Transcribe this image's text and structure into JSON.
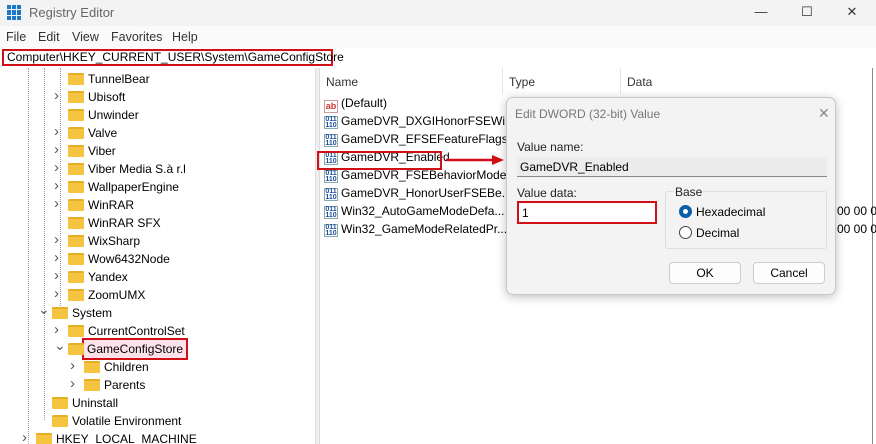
{
  "window": {
    "title": "Registry Editor",
    "minimize": "—",
    "maximize": "☐",
    "close": "✕"
  },
  "menu": [
    "File",
    "Edit",
    "View",
    "Favorites",
    "Help"
  ],
  "address": "Computer\\HKEY_CURRENT_USER\\System\\GameConfigStore",
  "tree": [
    {
      "label": "TunnelBear",
      "level": 3,
      "chev": ""
    },
    {
      "label": "Ubisoft",
      "level": 3,
      "chev": ">"
    },
    {
      "label": "Unwinder",
      "level": 3,
      "chev": ""
    },
    {
      "label": "Valve",
      "level": 3,
      "chev": ">"
    },
    {
      "label": "Viber",
      "level": 3,
      "chev": ">"
    },
    {
      "label": "Viber Media S.à r.l",
      "level": 3,
      "chev": ">"
    },
    {
      "label": "WallpaperEngine",
      "level": 3,
      "chev": ">"
    },
    {
      "label": "WinRAR",
      "level": 3,
      "chev": ">"
    },
    {
      "label": "WinRAR SFX",
      "level": 3,
      "chev": ""
    },
    {
      "label": "WixSharp",
      "level": 3,
      "chev": ">"
    },
    {
      "label": "Wow6432Node",
      "level": 3,
      "chev": ">"
    },
    {
      "label": "Yandex",
      "level": 3,
      "chev": ">"
    },
    {
      "label": "ZoomUMX",
      "level": 3,
      "chev": ">"
    },
    {
      "label": "System",
      "level": 2,
      "chev": "v"
    },
    {
      "label": "CurrentControlSet",
      "level": 3,
      "chev": ">"
    },
    {
      "label": "GameConfigStore",
      "level": 3,
      "chev": "v",
      "selected": true
    },
    {
      "label": "Children",
      "level": 4,
      "chev": ">"
    },
    {
      "label": "Parents",
      "level": 4,
      "chev": ">"
    },
    {
      "label": "Uninstall",
      "level": 2,
      "chev": ""
    },
    {
      "label": "Volatile Environment",
      "level": 2,
      "chev": ""
    },
    {
      "label": "HKEY_LOCAL_MACHINE",
      "level": 1,
      "chev": ">"
    }
  ],
  "columns": {
    "name": "Name",
    "type": "Type",
    "data": "Data"
  },
  "values": [
    {
      "name": "(Default)",
      "icon": "ab"
    },
    {
      "name": "GameDVR_DXGIHonorFSEWi...",
      "icon": "bin"
    },
    {
      "name": "GameDVR_EFSEFeatureFlags",
      "icon": "bin"
    },
    {
      "name": "GameDVR_Enabled",
      "icon": "bin",
      "highlighted": true
    },
    {
      "name": "GameDVR_FSEBehaviorMode",
      "icon": "bin"
    },
    {
      "name": "GameDVR_HonorUserFSEBe...",
      "icon": "bin"
    },
    {
      "name": "Win32_AutoGameModeDefa...",
      "icon": "bin",
      "data": "00 00 0"
    },
    {
      "name": "Win32_GameModeRelatedPr...",
      "icon": "bin",
      "data": "00 00 0"
    }
  ],
  "dialog": {
    "title": "Edit DWORD (32-bit) Value",
    "close": "✕",
    "value_name_label": "Value name:",
    "value_name": "GameDVR_Enabled",
    "value_data_label": "Value data:",
    "value_data": "1",
    "base_label": "Base",
    "hex_label": "Hexadecimal",
    "dec_label": "Decimal",
    "ok": "OK",
    "cancel": "Cancel"
  },
  "colors": {
    "accent_red": "#d10f16",
    "radio_blue": "#0a5ea8"
  }
}
